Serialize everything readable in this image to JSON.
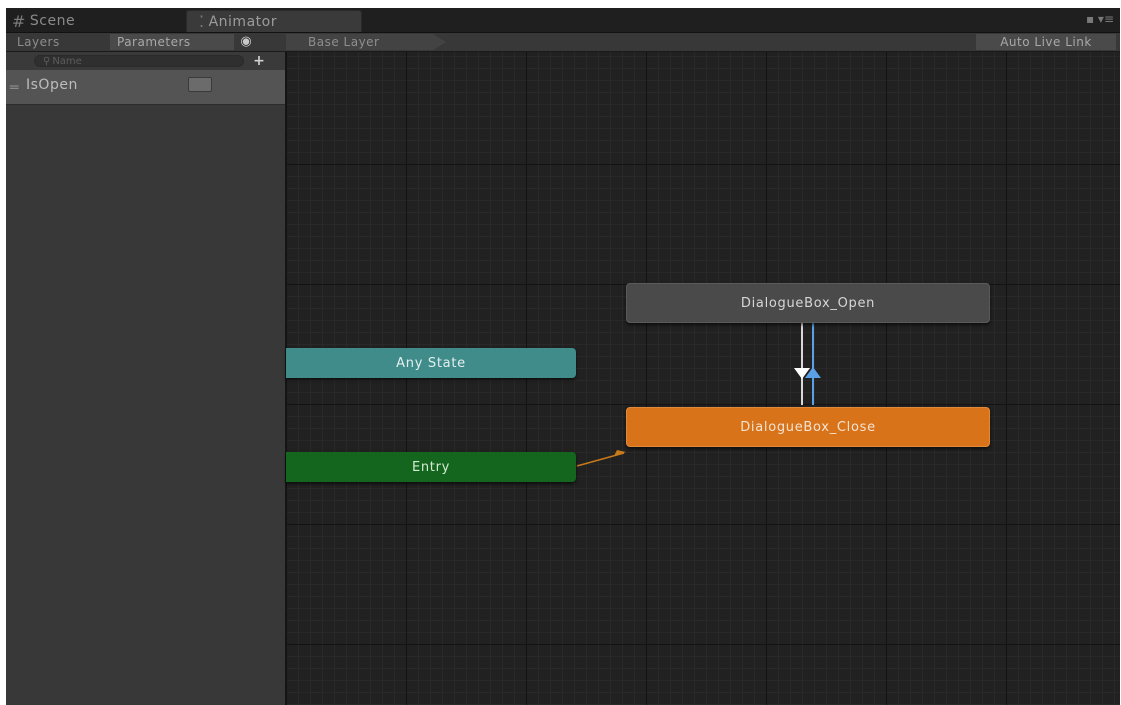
{
  "window_tabs": {
    "scene": {
      "icon": "scene-grid-icon",
      "label": "Scene"
    },
    "animator": {
      "icon": "animator-icon",
      "label": "Animator"
    }
  },
  "toolbar": {
    "layers_label": "Layers",
    "parameters_label": "Parameters",
    "visibility_icon": "eye-icon",
    "breadcrumb": "Base Layer",
    "auto_live_link": "Auto Live Link"
  },
  "parameters": {
    "search_placeholder": "Name",
    "add_icon": "plus-icon",
    "items": [
      {
        "name": "IsOpen",
        "type": "bool",
        "checked": false
      }
    ]
  },
  "graph": {
    "states": {
      "open": "DialogueBox_Open",
      "close": "DialogueBox_Close",
      "any": "Any State",
      "entry": "Entry"
    },
    "colors": {
      "default_state": "#4a4a4a",
      "orange_state": "#d8731a",
      "any_state": "#3f8c8a",
      "entry_state": "#14661f",
      "transition_down": "#ffffff",
      "transition_up": "#5aa0e6",
      "entry_transition": "#c87a1a"
    }
  }
}
